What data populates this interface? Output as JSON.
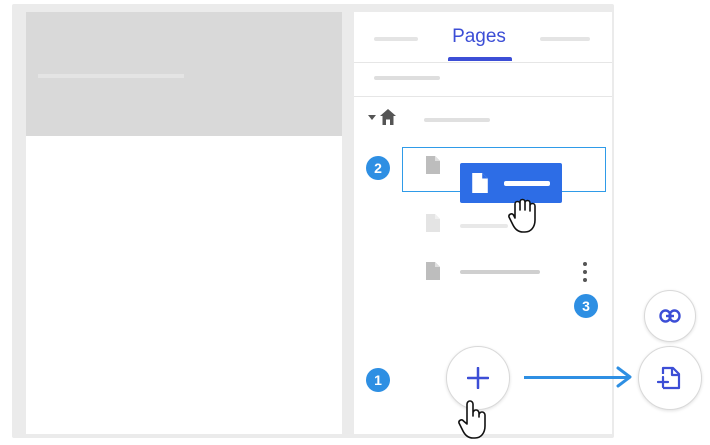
{
  "tabs": {
    "active_label": "Pages"
  },
  "tree": {
    "home_icon": "home-icon",
    "pages": [
      {
        "icon": "file-icon",
        "state": "drop-target"
      },
      {
        "icon": "file-icon",
        "state": "default"
      },
      {
        "icon": "file-icon",
        "state": "default"
      }
    ]
  },
  "drag": {
    "icon": "file-icon",
    "cursor": "grab-hand-icon"
  },
  "badges": {
    "step1": "1",
    "step2": "2",
    "step3": "3"
  },
  "actions": {
    "add_icon": "plus-icon",
    "link_icon": "link-icon",
    "new_page_icon": "new-page-icon",
    "more_icon": "more-vertical-icon",
    "click_cursor": "pointer-hand-icon"
  },
  "colors": {
    "accent": "#3c4ed6",
    "highlight": "#2f9be8",
    "drag_chip": "#2d6de6",
    "badge": "#2e8fe3"
  }
}
